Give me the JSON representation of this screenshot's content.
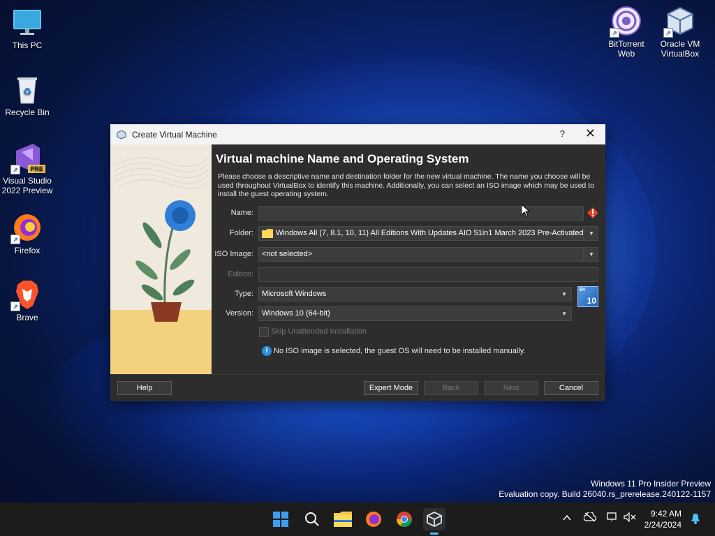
{
  "desktop": {
    "icons": [
      {
        "label": "This PC"
      },
      {
        "label": "Recycle Bin"
      },
      {
        "label": "Visual Studio 2022 Preview",
        "badge": "PRE"
      },
      {
        "label": "Firefox"
      },
      {
        "label": "Brave"
      },
      {
        "label": "BitTorrent Web"
      },
      {
        "label": "Oracle VM VirtualBox"
      }
    ]
  },
  "dialog": {
    "title": "Create Virtual Machine",
    "help_glyph": "?",
    "close_glyph": "✕",
    "heading": "Virtual machine Name and Operating System",
    "description": "Please choose a descriptive name and destination folder for the new virtual machine. The name you choose will be used throughout VirtualBox to identify this machine. Additionally, you can select an ISO image which may be used to install the guest operating system.",
    "fields": {
      "name_label": "Name:",
      "name_value": "",
      "folder_label": "Folder:",
      "folder_value": "Windows All (7, 8.1, 10, 11) All Editions With Updates AIO 51in1 March 2023 Pre-Activated",
      "iso_label": "ISO Image:",
      "iso_value": "<not selected>",
      "edition_label": "Edition:",
      "edition_value": "",
      "type_label": "Type:",
      "type_value": "Microsoft Windows",
      "version_label": "Version:",
      "version_value": "Windows 10 (64-bit)",
      "os_badge_top": "64",
      "os_badge_num": "10",
      "skip_label": "Skip Unattended Installation",
      "info_text": "No ISO image is selected, the guest OS will need to be installed manually."
    },
    "buttons": {
      "help": "Help",
      "expert": "Expert Mode",
      "back": "Back",
      "next": "Next",
      "cancel": "Cancel"
    }
  },
  "watermark": {
    "line1": "Windows 11 Pro Insider Preview",
    "line2": "Evaluation copy. Build 26040.rs_prerelease.240122-1157"
  },
  "taskbar": {
    "time": "9:42 AM",
    "date": "2/24/2024"
  }
}
